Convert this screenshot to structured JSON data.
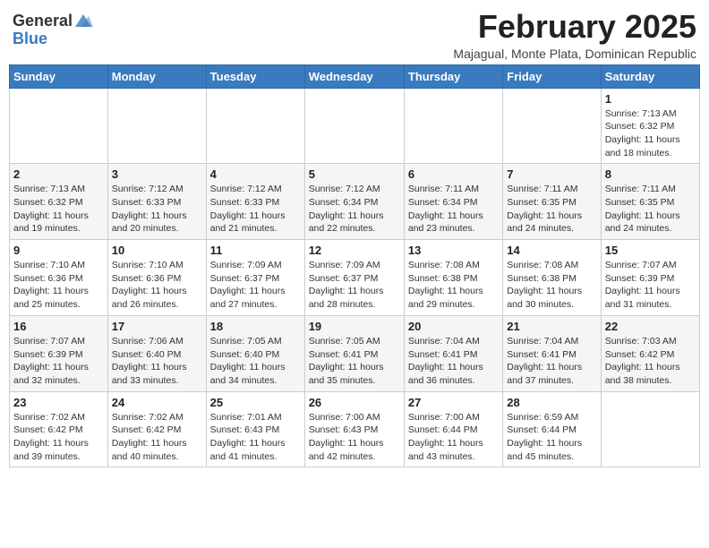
{
  "header": {
    "logo_general": "General",
    "logo_blue": "Blue",
    "month_year": "February 2025",
    "location": "Majagual, Monte Plata, Dominican Republic"
  },
  "days_of_week": [
    "Sunday",
    "Monday",
    "Tuesday",
    "Wednesday",
    "Thursday",
    "Friday",
    "Saturday"
  ],
  "weeks": [
    [
      {
        "day": "",
        "info": ""
      },
      {
        "day": "",
        "info": ""
      },
      {
        "day": "",
        "info": ""
      },
      {
        "day": "",
        "info": ""
      },
      {
        "day": "",
        "info": ""
      },
      {
        "day": "",
        "info": ""
      },
      {
        "day": "1",
        "info": "Sunrise: 7:13 AM\nSunset: 6:32 PM\nDaylight: 11 hours\nand 18 minutes."
      }
    ],
    [
      {
        "day": "2",
        "info": "Sunrise: 7:13 AM\nSunset: 6:32 PM\nDaylight: 11 hours\nand 19 minutes."
      },
      {
        "day": "3",
        "info": "Sunrise: 7:12 AM\nSunset: 6:33 PM\nDaylight: 11 hours\nand 20 minutes."
      },
      {
        "day": "4",
        "info": "Sunrise: 7:12 AM\nSunset: 6:33 PM\nDaylight: 11 hours\nand 21 minutes."
      },
      {
        "day": "5",
        "info": "Sunrise: 7:12 AM\nSunset: 6:34 PM\nDaylight: 11 hours\nand 22 minutes."
      },
      {
        "day": "6",
        "info": "Sunrise: 7:11 AM\nSunset: 6:34 PM\nDaylight: 11 hours\nand 23 minutes."
      },
      {
        "day": "7",
        "info": "Sunrise: 7:11 AM\nSunset: 6:35 PM\nDaylight: 11 hours\nand 24 minutes."
      },
      {
        "day": "8",
        "info": "Sunrise: 7:11 AM\nSunset: 6:35 PM\nDaylight: 11 hours\nand 24 minutes."
      }
    ],
    [
      {
        "day": "9",
        "info": "Sunrise: 7:10 AM\nSunset: 6:36 PM\nDaylight: 11 hours\nand 25 minutes."
      },
      {
        "day": "10",
        "info": "Sunrise: 7:10 AM\nSunset: 6:36 PM\nDaylight: 11 hours\nand 26 minutes."
      },
      {
        "day": "11",
        "info": "Sunrise: 7:09 AM\nSunset: 6:37 PM\nDaylight: 11 hours\nand 27 minutes."
      },
      {
        "day": "12",
        "info": "Sunrise: 7:09 AM\nSunset: 6:37 PM\nDaylight: 11 hours\nand 28 minutes."
      },
      {
        "day": "13",
        "info": "Sunrise: 7:08 AM\nSunset: 6:38 PM\nDaylight: 11 hours\nand 29 minutes."
      },
      {
        "day": "14",
        "info": "Sunrise: 7:08 AM\nSunset: 6:38 PM\nDaylight: 11 hours\nand 30 minutes."
      },
      {
        "day": "15",
        "info": "Sunrise: 7:07 AM\nSunset: 6:39 PM\nDaylight: 11 hours\nand 31 minutes."
      }
    ],
    [
      {
        "day": "16",
        "info": "Sunrise: 7:07 AM\nSunset: 6:39 PM\nDaylight: 11 hours\nand 32 minutes."
      },
      {
        "day": "17",
        "info": "Sunrise: 7:06 AM\nSunset: 6:40 PM\nDaylight: 11 hours\nand 33 minutes."
      },
      {
        "day": "18",
        "info": "Sunrise: 7:05 AM\nSunset: 6:40 PM\nDaylight: 11 hours\nand 34 minutes."
      },
      {
        "day": "19",
        "info": "Sunrise: 7:05 AM\nSunset: 6:41 PM\nDaylight: 11 hours\nand 35 minutes."
      },
      {
        "day": "20",
        "info": "Sunrise: 7:04 AM\nSunset: 6:41 PM\nDaylight: 11 hours\nand 36 minutes."
      },
      {
        "day": "21",
        "info": "Sunrise: 7:04 AM\nSunset: 6:41 PM\nDaylight: 11 hours\nand 37 minutes."
      },
      {
        "day": "22",
        "info": "Sunrise: 7:03 AM\nSunset: 6:42 PM\nDaylight: 11 hours\nand 38 minutes."
      }
    ],
    [
      {
        "day": "23",
        "info": "Sunrise: 7:02 AM\nSunset: 6:42 PM\nDaylight: 11 hours\nand 39 minutes."
      },
      {
        "day": "24",
        "info": "Sunrise: 7:02 AM\nSunset: 6:42 PM\nDaylight: 11 hours\nand 40 minutes."
      },
      {
        "day": "25",
        "info": "Sunrise: 7:01 AM\nSunset: 6:43 PM\nDaylight: 11 hours\nand 41 minutes."
      },
      {
        "day": "26",
        "info": "Sunrise: 7:00 AM\nSunset: 6:43 PM\nDaylight: 11 hours\nand 42 minutes."
      },
      {
        "day": "27",
        "info": "Sunrise: 7:00 AM\nSunset: 6:44 PM\nDaylight: 11 hours\nand 43 minutes."
      },
      {
        "day": "28",
        "info": "Sunrise: 6:59 AM\nSunset: 6:44 PM\nDaylight: 11 hours\nand 45 minutes."
      },
      {
        "day": "",
        "info": ""
      }
    ]
  ]
}
